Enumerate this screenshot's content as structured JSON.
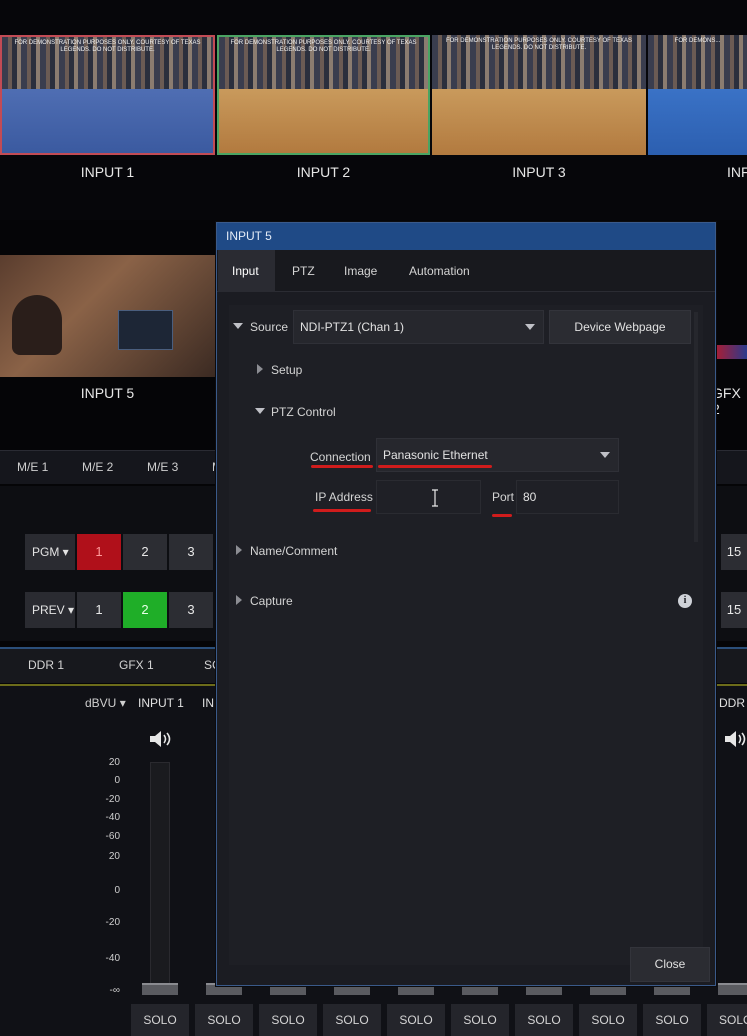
{
  "multiview": {
    "inputs": [
      {
        "label": "INPUT 1",
        "demo_text": "FOR DEMONSTRATION PURPOSES ONLY. COURTESY OF TEXAS LEGENDS. DO NOT DISTRIBUTE."
      },
      {
        "label": "INPUT 2",
        "demo_text": "FOR DEMONSTRATION PURPOSES ONLY. COURTESY OF TEXAS LEGENDS. DO NOT DISTRIBUTE."
      },
      {
        "label": "INPUT 3",
        "demo_text": "FOR DEMONSTRATION PURPOSES ONLY. COURTESY OF TEXAS LEGENDS. DO NOT DISTRIBUTE."
      },
      {
        "label": "INF",
        "demo_text": "FOR DEMONS..."
      }
    ],
    "input5_label": "INPUT 5",
    "gfx2_label": "GFX 2"
  },
  "switcher": {
    "me_tabs": [
      "M/E 1",
      "M/E 2",
      "M/E 3",
      "M"
    ],
    "pgm_label": "PGM",
    "prev_label": "PREV",
    "pgm_buttons": [
      "1",
      "2",
      "3"
    ],
    "prev_buttons": [
      "1",
      "2",
      "3"
    ],
    "right_edge_label": "15"
  },
  "bottom": {
    "tabs": [
      "DDR 1",
      "GFX 1",
      "SC"
    ],
    "dbvu_label": "dBVU",
    "channel_label": "INPUT 1",
    "channel_label_2": "IN",
    "ddr_right_label": "DDR",
    "scale_top": [
      "20",
      "0",
      "-20",
      "-40",
      "-60"
    ],
    "scale_bottom": [
      "20",
      "0",
      "-20",
      "-40",
      "-∞"
    ],
    "solo_label": "SOLO",
    "solo_partial": "SOLO"
  },
  "dialog": {
    "title": "INPUT 5",
    "tabs": [
      "Input",
      "PTZ",
      "Image",
      "Automation"
    ],
    "source_label": "Source",
    "source_value": "NDI-PTZ1 (Chan 1)",
    "device_webpage": "Device Webpage",
    "setup_label": "Setup",
    "ptz_control_label": "PTZ Control",
    "connection_label": "Connection",
    "connection_value": "Panasonic Ethernet",
    "ip_address_label": "IP Address",
    "ip_address_value": "",
    "port_label": "Port",
    "port_value": "80",
    "name_comment_label": "Name/Comment",
    "capture_label": "Capture",
    "info_glyph": "i",
    "close_label": "Close",
    "accent_title_bar": "#1f4a86",
    "highlight_underline": "#d01c1c"
  }
}
